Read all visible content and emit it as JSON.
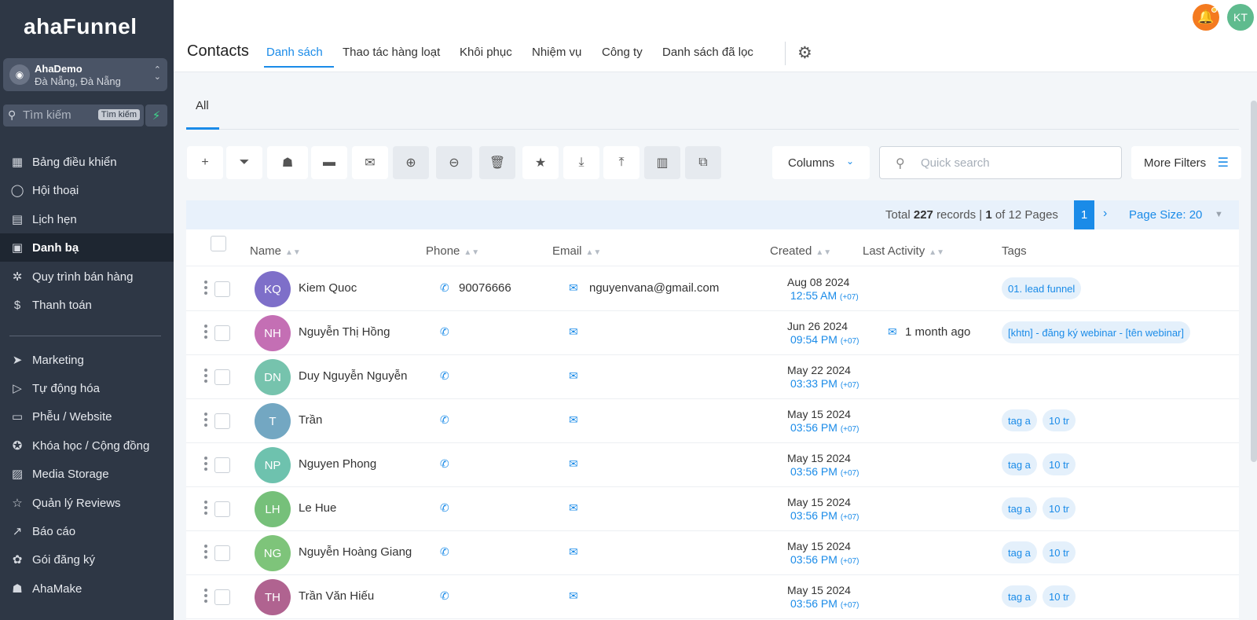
{
  "app": {
    "logo": "ahaFunnel"
  },
  "account": {
    "name": "AhaDemo",
    "location": "Đà Nẵng, Đà Nẵng",
    "icon": "location-icon"
  },
  "search": {
    "placeholder": "Tìm kiếm",
    "shortcut": "Tìm kiếm"
  },
  "sidebar": {
    "items": [
      {
        "label": "Bảng điều khiển",
        "icon": "dashboard-icon",
        "glyph": "▦"
      },
      {
        "label": "Hội thoại",
        "icon": "chat-icon",
        "glyph": "◯"
      },
      {
        "label": "Lịch hẹn",
        "icon": "calendar-icon",
        "glyph": "▤"
      },
      {
        "label": "Danh bạ",
        "icon": "contacts-icon",
        "glyph": "▣",
        "active": true
      },
      {
        "label": "Quy trình bán hàng",
        "icon": "pipeline-icon",
        "glyph": "✲"
      },
      {
        "label": "Thanh toán",
        "icon": "payment-icon",
        "glyph": "$"
      },
      {
        "label": "Marketing",
        "icon": "send-icon",
        "glyph": "➤"
      },
      {
        "label": "Tự động hóa",
        "icon": "automation-icon",
        "glyph": "▷"
      },
      {
        "label": "Phễu / Website",
        "icon": "website-icon",
        "glyph": "▭"
      },
      {
        "label": "Khóa học / Cộng đồng",
        "icon": "course-icon",
        "glyph": "✪"
      },
      {
        "label": "Media Storage",
        "icon": "image-icon",
        "glyph": "▨"
      },
      {
        "label": "Quản lý Reviews",
        "icon": "star-icon",
        "glyph": "☆"
      },
      {
        "label": "Báo cáo",
        "icon": "trend-icon",
        "glyph": "↗"
      },
      {
        "label": "Gói đăng ký",
        "icon": "badge-icon",
        "glyph": "✿"
      },
      {
        "label": "AhaMake",
        "icon": "robot-icon",
        "glyph": "☗"
      }
    ]
  },
  "header": {
    "title": "Contacts",
    "tabs": [
      "Danh sách",
      "Thao tác hàng loạt",
      "Khôi phục",
      "Nhiệm vụ",
      "Công ty",
      "Danh sách đã lọc"
    ],
    "user_initials": "KT"
  },
  "subtabs": {
    "all": "All"
  },
  "toolbar": {
    "buttons": [
      {
        "icon": "add-icon",
        "glyph": "+"
      },
      {
        "icon": "filter-icon",
        "glyph": "⏷"
      },
      {
        "icon": "robot-icon",
        "glyph": "☗"
      },
      {
        "icon": "message-icon",
        "glyph": "▬"
      },
      {
        "icon": "email-icon",
        "glyph": "✉"
      },
      {
        "icon": "add-tag-icon",
        "glyph": "⊕"
      },
      {
        "icon": "remove-tag-icon",
        "glyph": "⊖"
      },
      {
        "icon": "delete-icon",
        "glyph": "🗑"
      },
      {
        "icon": "star-icon",
        "glyph": "★"
      },
      {
        "icon": "download-icon",
        "glyph": "⤓"
      },
      {
        "icon": "upload-icon",
        "glyph": "⤒"
      },
      {
        "icon": "company-icon",
        "glyph": "▥"
      },
      {
        "icon": "merge-icon",
        "glyph": "⧉"
      }
    ],
    "columns_label": "Columns",
    "quick_search_placeholder": "Quick search",
    "more_filters_label": "More Filters"
  },
  "pagination": {
    "total_prefix": "Total",
    "total": "227",
    "records_label": "records",
    "page": "1",
    "pages_text": "of 12 Pages",
    "current_page": "1",
    "page_size_label": "Page Size: 20"
  },
  "table": {
    "columns": [
      "Name",
      "Phone",
      "Email",
      "Created",
      "Last Activity",
      "Tags"
    ],
    "rows": [
      {
        "initials": "KQ",
        "color": "#7e6fc9",
        "name": "Kiem Quoc",
        "phone": "90076666",
        "email": "nguyenvana@gmail.com",
        "created_date": "Aug 08 2024",
        "created_time": "12:55 AM",
        "tz": "(+07)",
        "last_activity": "",
        "tags": [
          "01. lead funnel"
        ]
      },
      {
        "initials": "NH",
        "color": "#c46fb4",
        "name": "Nguyễn Thị Hồng",
        "phone": "",
        "email": "",
        "created_date": "Jun 26 2024",
        "created_time": "09:54 PM",
        "tz": "(+07)",
        "last_activity": "1 month ago",
        "tags": [
          "[khtn] - đăng ký webinar - [tên webinar]"
        ]
      },
      {
        "initials": "DN",
        "color": "#76c3ad",
        "name": "Duy Nguyễn Nguyễn",
        "phone": "",
        "email": "",
        "created_date": "May 22 2024",
        "created_time": "03:33 PM",
        "tz": "(+07)",
        "last_activity": "",
        "tags": []
      },
      {
        "initials": "T",
        "color": "#73a7c2",
        "name": "Trần",
        "phone": "",
        "email": "",
        "created_date": "May 15 2024",
        "created_time": "03:56 PM",
        "tz": "(+07)",
        "last_activity": "",
        "tags": [
          "tag a",
          "10 tr"
        ]
      },
      {
        "initials": "NP",
        "color": "#6ec2ae",
        "name": "Nguyen Phong",
        "phone": "",
        "email": "",
        "created_date": "May 15 2024",
        "created_time": "03:56 PM",
        "tz": "(+07)",
        "last_activity": "",
        "tags": [
          "tag a",
          "10 tr"
        ]
      },
      {
        "initials": "LH",
        "color": "#76c07a",
        "name": "Le Hue",
        "phone": "",
        "email": "",
        "created_date": "May 15 2024",
        "created_time": "03:56 PM",
        "tz": "(+07)",
        "last_activity": "",
        "tags": [
          "tag a",
          "10 tr"
        ]
      },
      {
        "initials": "NG",
        "color": "#7ec47a",
        "name": "Nguyễn Hoàng Giang",
        "phone": "",
        "email": "",
        "created_date": "May 15 2024",
        "created_time": "03:56 PM",
        "tz": "(+07)",
        "last_activity": "",
        "tags": [
          "tag a",
          "10 tr"
        ]
      },
      {
        "initials": "TH",
        "color": "#b06390",
        "name": "Trần Văn Hiếu",
        "phone": "",
        "email": "",
        "created_date": "May 15 2024",
        "created_time": "03:56 PM",
        "tz": "(+07)",
        "last_activity": "",
        "tags": [
          "tag a",
          "10 tr"
        ]
      }
    ]
  }
}
